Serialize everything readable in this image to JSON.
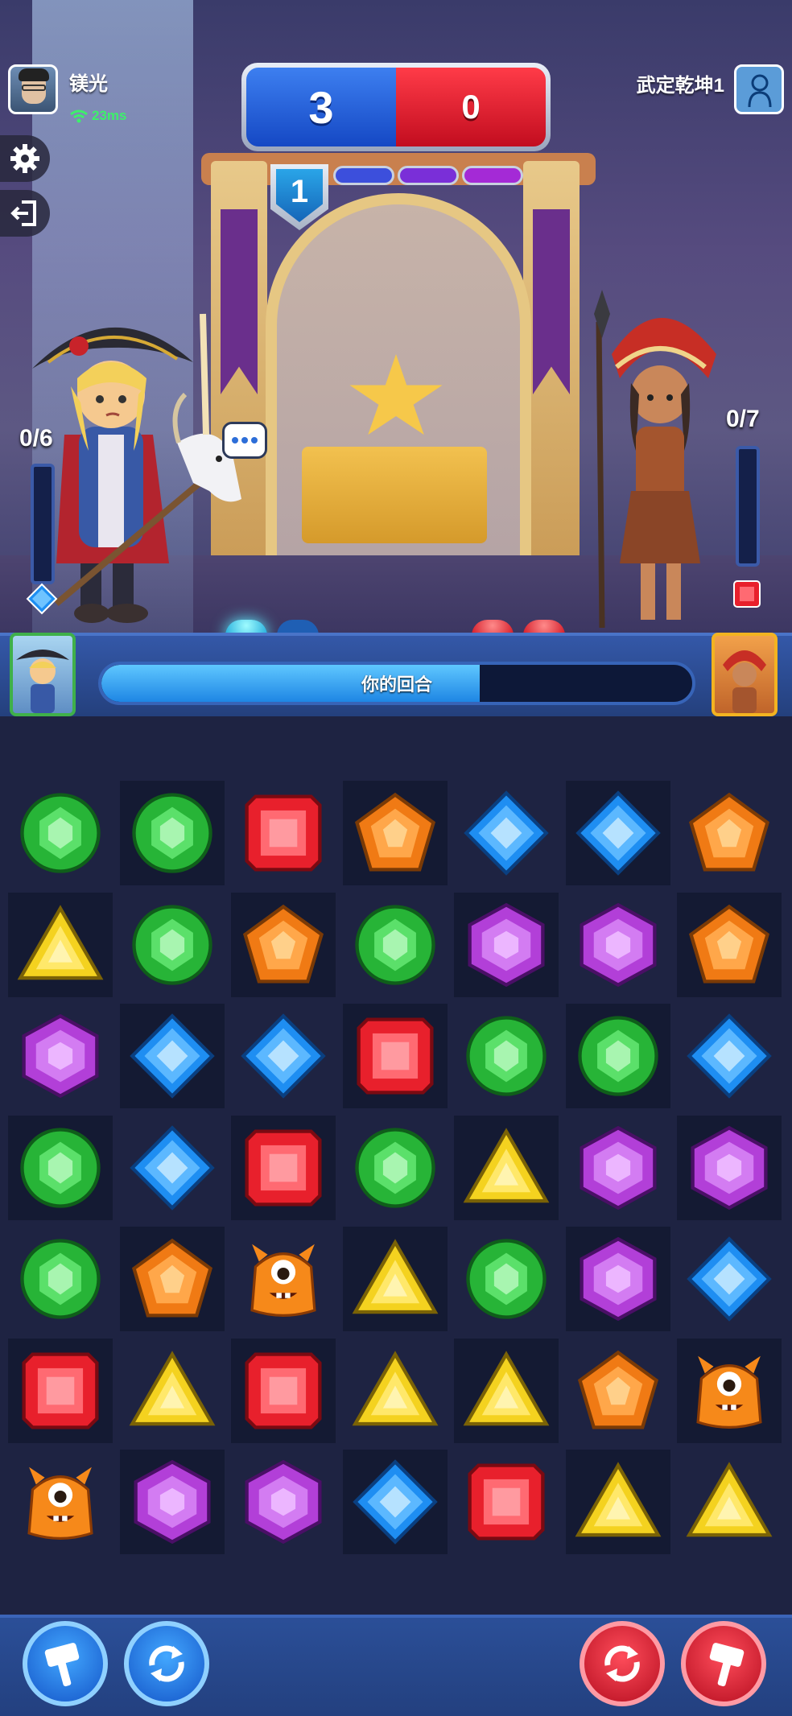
{
  "players": {
    "p1": {
      "name": "镁光",
      "ping": "23ms",
      "energy": "0/6",
      "energy_fill": 0
    },
    "p2": {
      "name": "武定乾坤1",
      "energy": "0/7",
      "energy_fill": 0
    }
  },
  "score": {
    "blue": "3",
    "red": "0"
  },
  "round": {
    "number": "1",
    "pills": [
      "blue",
      "purple",
      "magenta"
    ]
  },
  "turn": {
    "label": "你的回合",
    "progress": 0.64
  },
  "lights": {
    "p1": [
      "on-blue",
      "off-blue"
    ],
    "p2": [
      "on-red",
      "on-red"
    ]
  },
  "colors": {
    "g": "#27b437",
    "r": "#e8202c",
    "o": "#f07a14",
    "b": "#1e8ef2",
    "p": "#b23fd8",
    "y": "#f4d21f",
    "m": "#f6891a"
  },
  "board": [
    [
      "g",
      "g",
      "r",
      "o",
      "b",
      "b",
      "o"
    ],
    [
      "y",
      "g",
      "o",
      "g",
      "p",
      "p",
      "o"
    ],
    [
      "p",
      "b",
      "b",
      "r",
      "g",
      "g",
      "b"
    ],
    [
      "g",
      "b",
      "r",
      "g",
      "y",
      "p",
      "p"
    ],
    [
      "g",
      "o",
      "m",
      "y",
      "g",
      "p",
      "b"
    ],
    [
      "r",
      "y",
      "r",
      "y",
      "y",
      "o",
      "m"
    ],
    [
      "m",
      "p",
      "p",
      "b",
      "r",
      "y",
      "y"
    ]
  ],
  "board_dark": [
    [
      0,
      1,
      0,
      1,
      0,
      1,
      0
    ],
    [
      1,
      0,
      1,
      0,
      1,
      0,
      1
    ],
    [
      0,
      1,
      0,
      1,
      0,
      1,
      0
    ],
    [
      1,
      0,
      1,
      0,
      1,
      0,
      1
    ],
    [
      0,
      1,
      0,
      1,
      0,
      1,
      0
    ],
    [
      1,
      0,
      1,
      0,
      1,
      0,
      1
    ],
    [
      0,
      1,
      0,
      1,
      0,
      1,
      0
    ]
  ],
  "gem_names": {
    "g": "green-round-gem",
    "r": "red-square-gem",
    "o": "orange-pentagon-gem",
    "b": "blue-diamond-gem",
    "p": "purple-hexagon-gem",
    "y": "yellow-triangle-gem",
    "m": "orange-monster-icon"
  },
  "tools": {
    "p1_hammer": "hammer-icon",
    "p1_shuffle": "shuffle-icon",
    "p2_shuffle": "shuffle-icon",
    "p2_hammer": "hammer-icon"
  }
}
